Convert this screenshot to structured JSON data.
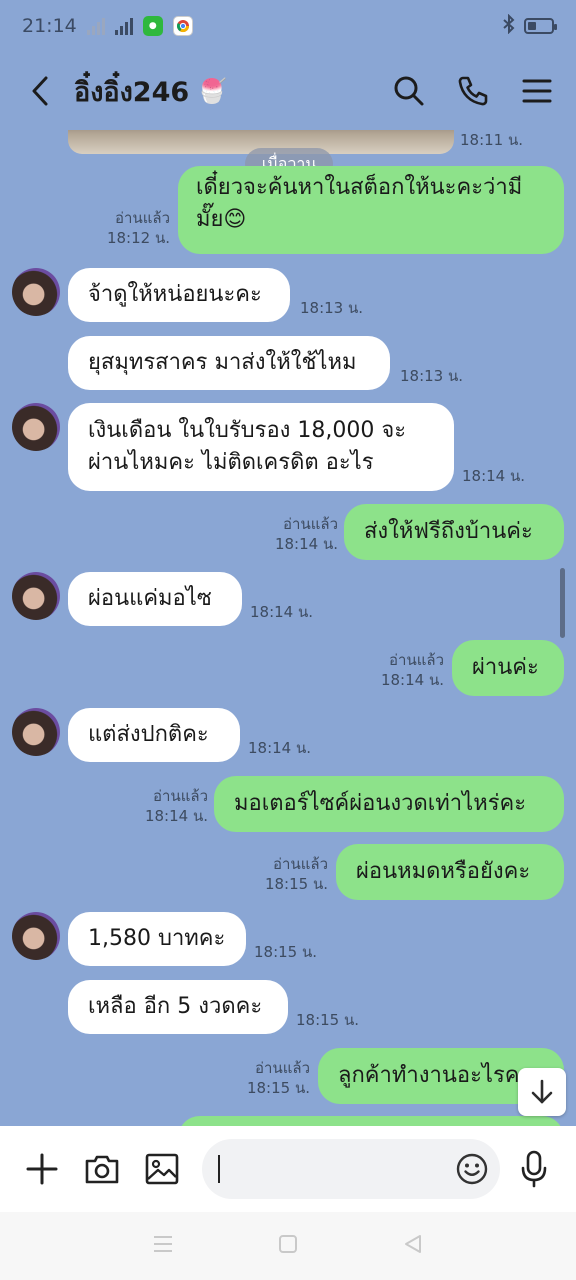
{
  "status_bar": {
    "time": "21:14",
    "network": "4G"
  },
  "header": {
    "title": "อิ๋งอิ๋ง246",
    "title_emoji": "🍧"
  },
  "chat": {
    "top_image_time": "18:11 น.",
    "date_divider": "เมื่อวาน",
    "messages": [
      {
        "dir": "out",
        "text": "เดี๋ยวจะค้นหาในสต็อกให้นะคะว่ามีมั๊ย😊",
        "read": "อ่านแล้ว",
        "time": "18:12 น."
      },
      {
        "dir": "in",
        "text": "จ้าดูให้หน่อยนะคะ",
        "time": "18:13 น."
      },
      {
        "dir": "in",
        "text": "ยุสมุทรสาคร มาส่งให้ใช้ไหม",
        "time": "18:13 น."
      },
      {
        "dir": "in",
        "text": "เงินเดือน ในใบรับรอง 18,000 จะผ่านไหมคะ ไม่ติดเครดิต อะไร",
        "time": "18:14 น."
      },
      {
        "dir": "out",
        "text": "ส่งให้ฟรีถึงบ้านค่ะ",
        "read": "อ่านแล้ว",
        "time": "18:14 น."
      },
      {
        "dir": "in",
        "text": "ผ่อนแค่มอไซ",
        "time": "18:14 น."
      },
      {
        "dir": "out",
        "text": "ผ่านค่ะ",
        "read": "อ่านแล้ว",
        "time": "18:14 น."
      },
      {
        "dir": "in",
        "text": "แต่ส่งปกติคะ",
        "time": "18:14 น."
      },
      {
        "dir": "out",
        "text": "มอเตอร์ไซค์ผ่อนงวดเท่าไหร่คะ",
        "read": "อ่านแล้ว",
        "time": "18:14 น."
      },
      {
        "dir": "out",
        "text": "ผ่อนหมดหรือยังคะ",
        "read": "อ่านแล้ว",
        "time": "18:15 น."
      },
      {
        "dir": "in",
        "text": "1,580 บาทคะ",
        "time": "18:15 น."
      },
      {
        "dir": "in",
        "text": "เหลือ อีก 5 งวดคะ",
        "time": "18:15 น."
      },
      {
        "dir": "out",
        "text": "ลูกค้าทำงานอะไรคะ",
        "read": "อ่านแล้ว",
        "time": "18:15 น."
      }
    ]
  },
  "input": {
    "placeholder": ""
  },
  "icons": {
    "back": "chevron-left-icon",
    "search": "search-icon",
    "call": "phone-icon",
    "menu": "hamburger-icon",
    "add": "plus-icon",
    "camera": "camera-icon",
    "gallery": "image-icon",
    "emoji": "smiley-icon",
    "mic": "microphone-icon",
    "scroll_down": "arrow-down-icon"
  },
  "colors": {
    "background": "#8aa6d4",
    "outgoing_bubble": "#8de28a",
    "incoming_bubble": "#ffffff"
  }
}
